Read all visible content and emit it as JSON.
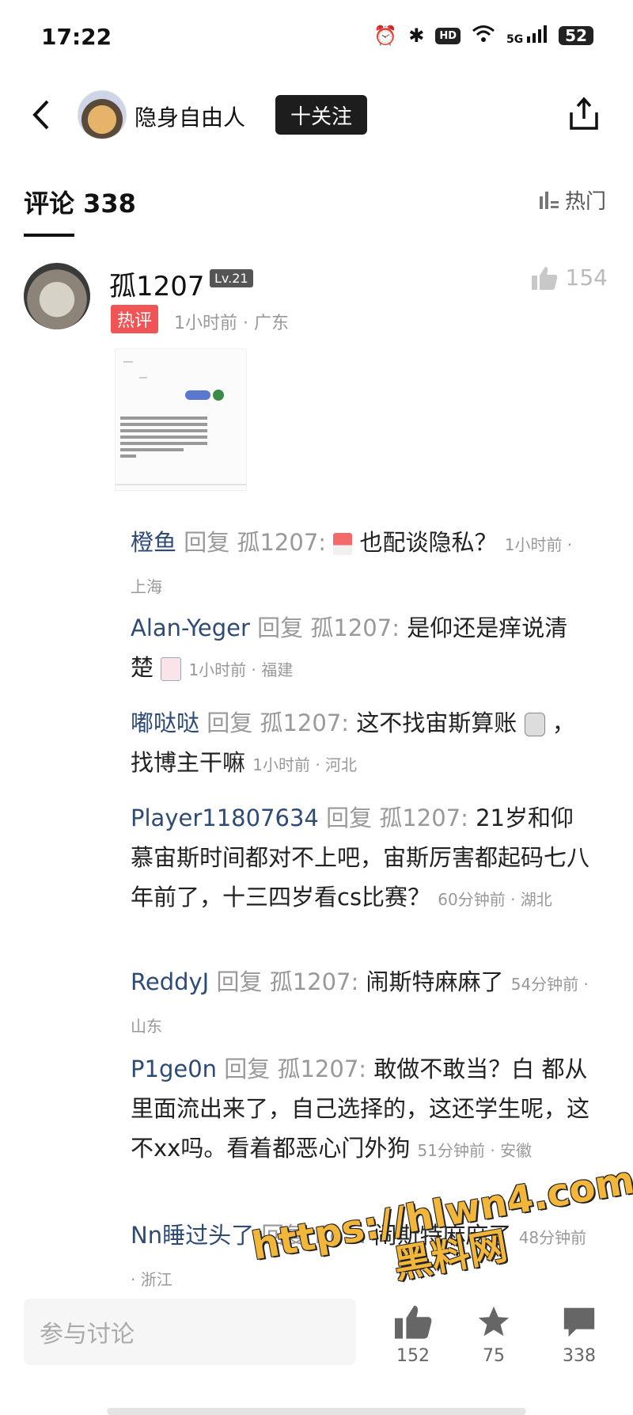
{
  "status_bar": {
    "time": "17:22",
    "network": "5G",
    "hd": "HD",
    "battery": "52"
  },
  "header": {
    "username": "隐身自由人",
    "follow_label": "十关注"
  },
  "comments_tab": {
    "title": "评论 338",
    "sort_label": "热门"
  },
  "main_comment": {
    "username": "孤1207",
    "level": "Lv.21",
    "hot_badge": "热评",
    "meta": "1小时前 · 广东",
    "likes": "154"
  },
  "replies": [
    {
      "user": "橙鱼",
      "reply_kw": "回复",
      "target": "孤1207:",
      "text": "也配谈隐私？",
      "meta": "1小时前 · 上海",
      "emoji": "red-white-square"
    },
    {
      "user": "Alan-Yeger",
      "reply_kw": "回复",
      "target": "孤1207:",
      "text": "是仰还是痒说清楚",
      "meta": "1小时前 · 福建",
      "emoji": "pink-face"
    },
    {
      "user": "嘟哒哒",
      "reply_kw": "回复",
      "target": "孤1207:",
      "text": "这不找宙斯算账",
      "text2": "，找博主干嘛",
      "meta": "1小时前 · 河北",
      "emoji": "gray-face"
    },
    {
      "user": "Player11807634",
      "reply_kw": "回复",
      "target": "孤1207:",
      "text": "21岁和仰慕宙斯时间都对不上吧，宙斯厉害都起码七八年前了，十三四岁看cs比赛？",
      "meta": "60分钟前 · 湖北"
    },
    {
      "user": "ReddyJ",
      "reply_kw": "回复",
      "target": "孤1207:",
      "text": "闹斯特麻麻了",
      "meta": "54分钟前 · 山东"
    },
    {
      "user": "P1ge0n",
      "reply_kw": "回复",
      "target": "孤1207:",
      "text": "敢做不敢当？白",
      "text2": "都从里面流出来了，自己选择的，这还学生呢，这不xx吗。看着都恶心门外狗",
      "meta": "51分钟前 · 安徽"
    },
    {
      "user": "Nn睡过头了",
      "reply_kw": "回复",
      "target": "Re…",
      "text": "闹斯特麻麻了",
      "meta": "48分钟前 · 浙江"
    }
  ],
  "bottom_bar": {
    "input_placeholder": "参与讨论",
    "likes": "152",
    "favorites": "75",
    "comments": "338"
  },
  "watermark": {
    "line1": "https://hlwn4.com",
    "line2": "黑料网"
  },
  "colors": {
    "username_blue": "#2e4b75",
    "hot_red": "#f05454",
    "watermark_yellow": "#f2b63a"
  }
}
